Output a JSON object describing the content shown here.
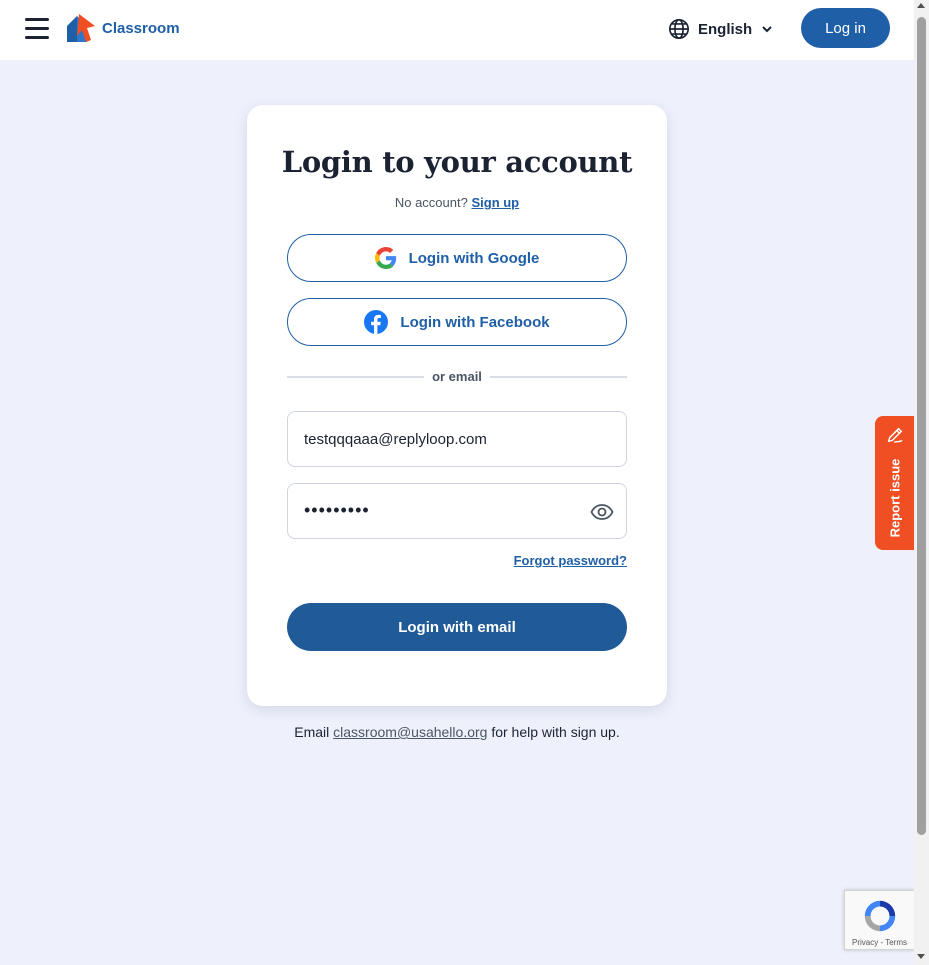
{
  "header": {
    "logo_text": "Classroom",
    "language": "English",
    "login_button": "Log in"
  },
  "card": {
    "title": "Login to your account",
    "no_account": "No account?",
    "sign_up": "Sign up",
    "google_label": "Login with Google",
    "facebook_label": "Login with Facebook",
    "divider": "or email",
    "email_value": "testqqqaaa@replyloop.com",
    "password_value": "•••••••••",
    "forgot": "Forgot password?",
    "submit": "Login with email"
  },
  "help": {
    "prefix": "Email",
    "email": "classroom@usahello.org",
    "suffix": "for help with sign up."
  },
  "report": {
    "label": "Report issue"
  },
  "recaptcha": {
    "privacy": "Privacy",
    "sep": " - ",
    "terms": "Terms"
  },
  "colors": {
    "brand": "#1f5fa7",
    "accent": "#f04e23",
    "background": "#eef1fc"
  }
}
